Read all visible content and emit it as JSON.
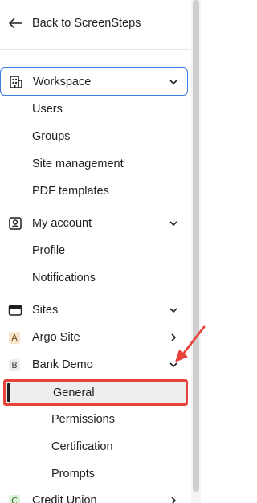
{
  "back_link": {
    "label": "Back to ScreenSteps"
  },
  "workspace": {
    "label": "Workspace",
    "items": [
      {
        "label": "Users"
      },
      {
        "label": "Groups"
      },
      {
        "label": "Site management"
      },
      {
        "label": "PDF templates"
      }
    ]
  },
  "my_account": {
    "label": "My account",
    "items": [
      {
        "label": "Profile"
      },
      {
        "label": "Notifications"
      }
    ]
  },
  "sites": {
    "label": "Sites",
    "list": [
      {
        "badge": "A",
        "label": "Argo Site"
      },
      {
        "badge": "B",
        "label": "Bank Demo",
        "items": [
          {
            "label": "General",
            "selected": true
          },
          {
            "label": "Permissions"
          },
          {
            "label": "Certification"
          },
          {
            "label": "Prompts"
          }
        ]
      },
      {
        "badge": "C",
        "label": "Credit Union"
      }
    ]
  },
  "colors": {
    "focus_outline": "#3b7bd8",
    "highlight_box": "#e8433a",
    "annotation_arrow": "#e8433a"
  },
  "icons": {
    "back": "arrow-left-icon",
    "workspace": "building-icon",
    "my_account": "user-badge-icon",
    "sites": "browser-window-icon",
    "expanded": "chevron-down-icon",
    "collapsed": "chevron-right-icon"
  }
}
